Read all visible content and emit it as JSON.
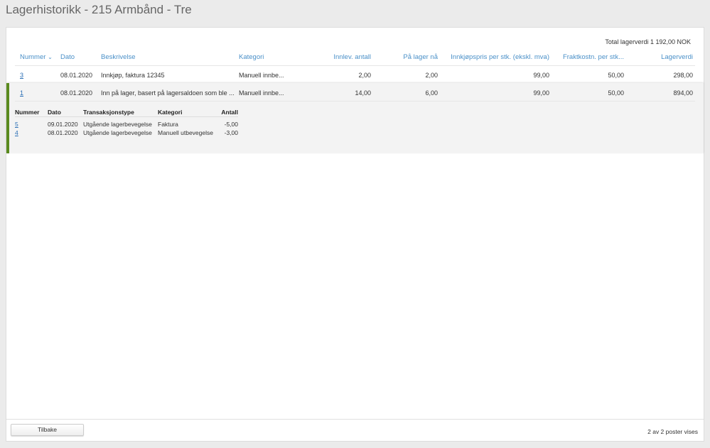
{
  "title": "Lagerhistorikk - 215 Armbånd - Tre",
  "total_label": "Total lagerverdi 1 192,00 NOK",
  "columns": {
    "nummer": "Nummer",
    "dato": "Dato",
    "beskrivelse": "Beskrivelse",
    "kategori": "Kategori",
    "innlev": "Innlev. antall",
    "paa_lager": "På lager nå",
    "innkjopspris": "Innkjøpspris per stk. (ekskl. mva)",
    "fraktkostn": "Fraktkostn. per stk...",
    "lagerverdi": "Lagerverdi"
  },
  "sort_icon": "chevron-down-icon",
  "rows": [
    {
      "nummer": "3",
      "dato": "08.01.2020",
      "beskrivelse": "Innkjøp, faktura 12345",
      "kategori": "Manuell innbe...",
      "innlev": "2,00",
      "paa_lager": "2,00",
      "innkjopspris": "99,00",
      "fraktkostn": "50,00",
      "lagerverdi": "298,00"
    },
    {
      "nummer": "1",
      "dato": "08.01.2020",
      "beskrivelse": "Inn på lager, basert på lagersaldoen som ble ...",
      "kategori": "Manuell innbe...",
      "innlev": "14,00",
      "paa_lager": "6,00",
      "innkjopspris": "99,00",
      "fraktkostn": "50,00",
      "lagerverdi": "894,00"
    }
  ],
  "subtable": {
    "columns": {
      "nummer": "Nummer",
      "dato": "Dato",
      "type": "Transaksjonstype",
      "kategori": "Kategori",
      "antall": "Antall"
    },
    "rows": [
      {
        "nummer": "5",
        "dato": "09.01.2020",
        "type": "Utgående lagerbevegelse",
        "kategori": "Faktura",
        "antall": "-5,00"
      },
      {
        "nummer": "4",
        "dato": "08.01.2020",
        "type": "Utgående lagerbevegelse",
        "kategori": "Manuell utbevegelse",
        "antall": "-3,00"
      }
    ]
  },
  "accent_color": "#5a8a1e",
  "footer": {
    "back_label": "Tilbake",
    "count_label": "2 av 2 poster vises"
  }
}
